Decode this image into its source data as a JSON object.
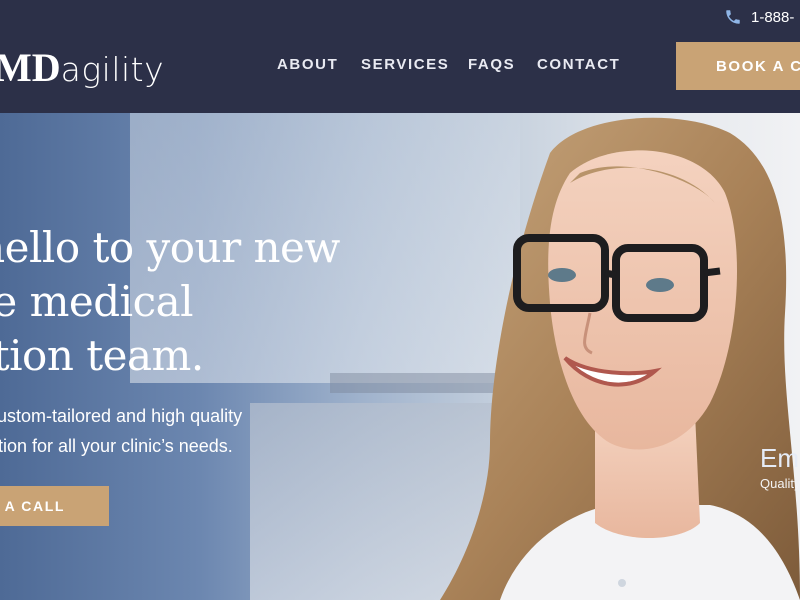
{
  "header": {
    "phone_label": "1-888-",
    "logo": {
      "md": "MD",
      "agility": "agility"
    },
    "nav": [
      {
        "label": "ABOUT"
      },
      {
        "label": "SERVICES"
      },
      {
        "label": "FAQS"
      },
      {
        "label": "CONTACT"
      }
    ],
    "book_label": "BOOK A CA"
  },
  "hero": {
    "title_lines": [
      "y hello to your new",
      "site medical",
      "eption team."
    ],
    "subtitle_lines": [
      "custom-tailored and high quality",
      "ation for all your clinic’s needs."
    ],
    "cta_label": "K A CALL",
    "caption_name": "Em",
    "caption_role": "Quality"
  },
  "colors": {
    "header_bg": "#2c3048",
    "accent": "#c9a375"
  }
}
